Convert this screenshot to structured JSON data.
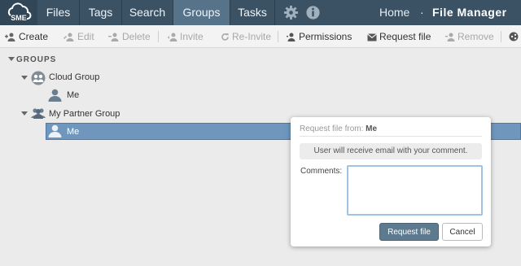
{
  "brand": {
    "logo_text": "SME"
  },
  "nav": {
    "tabs": [
      "Files",
      "Tags",
      "Search",
      "Groups",
      "Tasks"
    ],
    "active_tab": "Groups",
    "icons": [
      "gear-icon",
      "info-icon"
    ],
    "home_label": "Home",
    "separator": "·",
    "app_title": "File Manager"
  },
  "toolbar": {
    "create": "Create",
    "edit": "Edit",
    "delete": "Delete",
    "invite": "Invite",
    "reinvite": "Re-Invite",
    "permissions": "Permissions",
    "request_file": "Request file",
    "remove": "Remove"
  },
  "tree": {
    "heading": "GROUPS",
    "groups": [
      {
        "name": "Cloud Group",
        "members": [
          "Me"
        ]
      },
      {
        "name": "My Partner Group",
        "members": [
          "Me"
        ]
      }
    ]
  },
  "popover": {
    "title_prefix": "Request file from:",
    "title_name": "Me",
    "notice": "User will receive email with your comment.",
    "comments_label": "Comments:",
    "comments_value": "",
    "submit_label": "Request file",
    "cancel_label": "Cancel"
  },
  "colors": {
    "topbar": "#3a5264",
    "active_tab": "#57738a",
    "selection": "#6f97bd",
    "primary_button": "#5e7a8e"
  }
}
